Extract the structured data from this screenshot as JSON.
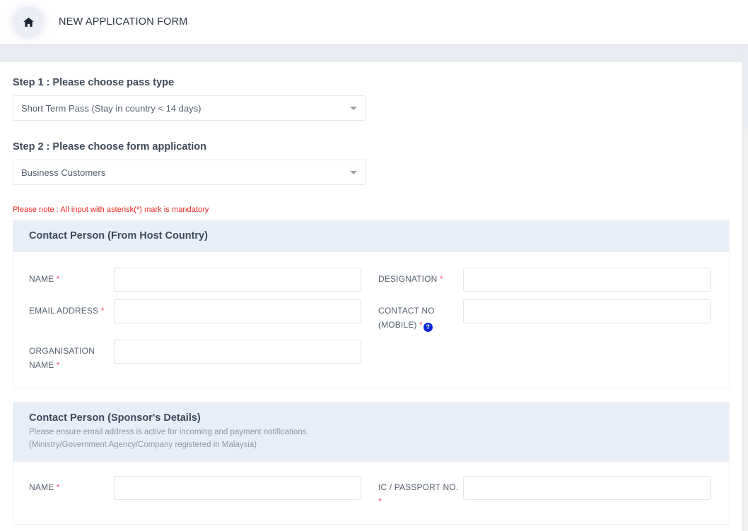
{
  "header": {
    "home_icon": "home-icon",
    "title": "NEW APPLICATION FORM"
  },
  "steps": [
    {
      "label": "Step 1 : Please choose pass type",
      "selected": "Short Term Pass (Stay in country < 14 days)",
      "caret_icon": "chevron-down-icon"
    },
    {
      "label": "Step 2 : Please choose form application",
      "selected": "Business Customers",
      "caret_icon": "chevron-down-icon"
    }
  ],
  "note": "Please note : All input with asterisk(*) mark is mandatory",
  "sections": [
    {
      "title": "Contact Person (From Host Country)",
      "subtitle_lines": [],
      "rows": [
        {
          "left": {
            "label": "NAME",
            "required": true,
            "value": "",
            "placeholder": ""
          },
          "right": {
            "label": "DESIGNATION",
            "required": true,
            "value": "",
            "placeholder": ""
          }
        },
        {
          "left": {
            "label": "EMAIL ADDRESS",
            "required": true,
            "value": "",
            "placeholder": ""
          },
          "right": {
            "label": "CONTACT NO (MOBILE)",
            "required": true,
            "help": "?",
            "value": "",
            "placeholder": ""
          }
        },
        {
          "left": {
            "label": "ORGANISATION NAME",
            "required": true,
            "value": "",
            "placeholder": ""
          },
          "right": null
        }
      ]
    },
    {
      "title": "Contact Person (Sponsor's Details)",
      "subtitle_lines": [
        "Please ensure email address is active for incoming and payment notifications.",
        "(Ministry/Government Agency/Company registered in Malaysia)"
      ],
      "rows": [
        {
          "left": {
            "label": "NAME",
            "required": true,
            "value": "",
            "placeholder": ""
          },
          "right": {
            "label": "IC / PASSPORT NO.",
            "required": true,
            "value": "",
            "placeholder": ""
          }
        }
      ]
    }
  ],
  "colors": {
    "accent_band": "#e8eef7",
    "gray_band": "#e9ebf2",
    "required_asterisk": "#f4506a",
    "note_red": "#e8251f",
    "help_blue": "#0a28d8",
    "input_border": "#dde5ef"
  }
}
